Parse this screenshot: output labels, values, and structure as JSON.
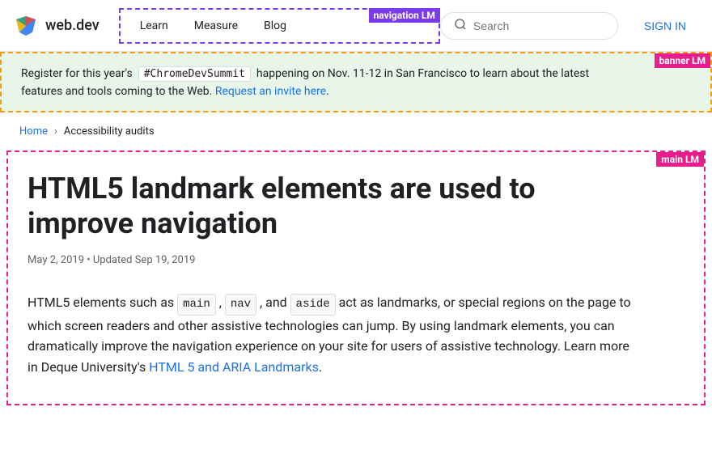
{
  "header": {
    "logo_text": "web.dev",
    "nav": {
      "label": "navigation LM",
      "items": [
        "Learn",
        "Measure",
        "Blog"
      ]
    },
    "search": {
      "placeholder": "Search"
    },
    "sign_in": "SIGN IN"
  },
  "banner": {
    "label": "banner LM",
    "text_before": "Register for this year's",
    "hashtag": "#ChromeDevSummit",
    "text_after": "happening on Nov. 11-12 in San Francisco to learn about the latest features and tools coming to the Web.",
    "link_text": "Request an invite here",
    "link_url": "#"
  },
  "breadcrumb": {
    "home": "Home",
    "separator": "›",
    "current": "Accessibility audits"
  },
  "main": {
    "label": "main LM",
    "article": {
      "title": "HTML5 landmark elements are used to improve navigation",
      "date": "May 2, 2019",
      "updated": "Updated Sep 19, 2019",
      "body_before": "HTML5 elements such as",
      "code1": "main",
      "comma1": ",",
      "code2": "nav",
      "comma2": ", and",
      "code3": "aside",
      "body_after": "act as landmarks, or special regions on the page to which screen readers and other assistive technologies can jump. By using landmark elements, you can dramatically improve the navigation experience on your site for users of assistive technology. Learn more in Deque University's",
      "link_text": "HTML 5 and ARIA Landmarks",
      "link_url": "#",
      "body_end": "."
    }
  }
}
